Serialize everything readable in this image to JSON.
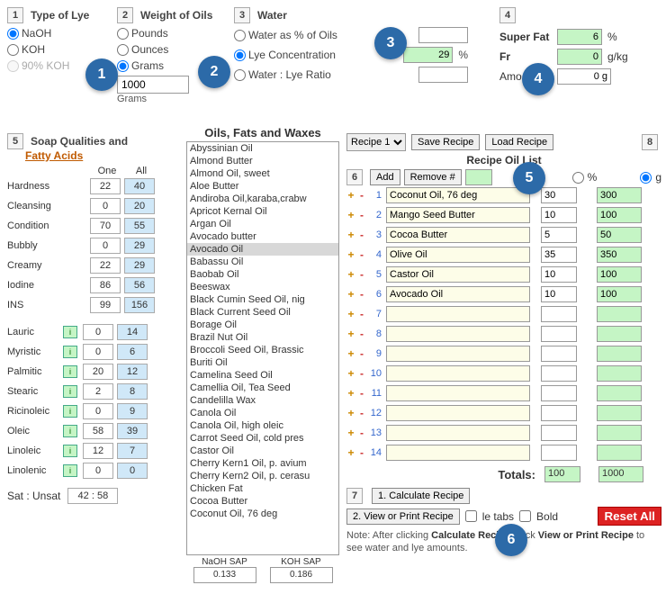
{
  "panel1": {
    "title": "Type of Lye",
    "opts": [
      "NaOH",
      "KOH",
      "90% KOH"
    ],
    "selected": 0
  },
  "panel2": {
    "title": "Weight of Oils",
    "opts": [
      "Pounds",
      "Ounces",
      "Grams"
    ],
    "selected": 2,
    "value": "1000",
    "unit_label": "Grams"
  },
  "panel3": {
    "title": "Water",
    "opts": [
      "Water as % of Oils",
      "Lye Concentration",
      "Water : Lye Ratio"
    ],
    "selected": 1,
    "values": [
      "",
      "29",
      ""
    ],
    "pct": "%"
  },
  "panel4": {
    "step": "4",
    "rows": [
      {
        "label": "Super Fat",
        "value": "6",
        "unit": "%"
      },
      {
        "label": "Fr",
        "value": "0",
        "unit": "g/kg"
      },
      {
        "label": "Amo",
        "value": "0 g",
        "unit": ""
      }
    ]
  },
  "soap_qualities": {
    "step": "5",
    "title": "Soap Qualities and",
    "fatty_acids": "Fatty Acids",
    "col_one": "One",
    "col_all": "All",
    "rows": [
      {
        "label": "Hardness",
        "one": "22",
        "all": "40"
      },
      {
        "label": "Cleansing",
        "one": "0",
        "all": "20"
      },
      {
        "label": "Condition",
        "one": "70",
        "all": "55"
      },
      {
        "label": "Bubbly",
        "one": "0",
        "all": "29"
      },
      {
        "label": "Creamy",
        "one": "22",
        "all": "29"
      },
      {
        "label": "Iodine",
        "one": "86",
        "all": "56"
      },
      {
        "label": "INS",
        "one": "99",
        "all": "156"
      }
    ],
    "acids": [
      {
        "label": "Lauric",
        "one": "0",
        "all": "14"
      },
      {
        "label": "Myristic",
        "one": "0",
        "all": "6"
      },
      {
        "label": "Palmitic",
        "one": "20",
        "all": "12"
      },
      {
        "label": "Stearic",
        "one": "2",
        "all": "8"
      },
      {
        "label": "Ricinoleic",
        "one": "0",
        "all": "9"
      },
      {
        "label": "Oleic",
        "one": "58",
        "all": "39"
      },
      {
        "label": "Linoleic",
        "one": "12",
        "all": "7"
      },
      {
        "label": "Linolenic",
        "one": "0",
        "all": "0"
      }
    ],
    "sat_label": "Sat : Unsat",
    "sat_value": "42 : 58"
  },
  "oils": {
    "title": "Oils, Fats and Waxes",
    "list": [
      "Abyssinian Oil",
      "Almond Butter",
      "Almond Oil, sweet",
      "Aloe Butter",
      "Andiroba Oil,karaba,crabw",
      "Apricot Kernal Oil",
      "Argan Oil",
      "Avocado butter",
      "Avocado Oil",
      "Babassu Oil",
      "Baobab Oil",
      "Beeswax",
      "Black Cumin Seed Oil, nig",
      "Black Current Seed Oil",
      "Borage Oil",
      "Brazil Nut Oil",
      "Broccoli Seed Oil, Brassic",
      "Buriti Oil",
      "Camelina Seed Oil",
      "Camellia Oil, Tea Seed",
      "Candelilla Wax",
      "Canola Oil",
      "Canola Oil, high oleic",
      "Carrot Seed Oil, cold pres",
      "Castor Oil",
      "Cherry Kern1 Oil, p. avium",
      "Cherry Kern2 Oil, p. cerasu",
      "Chicken Fat",
      "Cocoa Butter",
      "Coconut Oil, 76 deg"
    ],
    "selected_index": 8,
    "sap": {
      "naoh_label": "NaOH SAP",
      "koh_label": "KOH SAP",
      "naoh_value": "0.133",
      "koh_value": "0.186"
    }
  },
  "recipe": {
    "select_label": "Recipe 1",
    "save_btn": "Save Recipe",
    "load_btn": "Load Recipe",
    "step8": "8",
    "title": "Recipe Oil List",
    "step6": "6",
    "add_btn": "Add",
    "remove_btn": "Remove #",
    "remove_value": "",
    "pct_label": "%",
    "g_label": "g",
    "rows": [
      {
        "name": "Coconut Oil, 76 deg",
        "pct": "30",
        "g": "300"
      },
      {
        "name": "Mango Seed Butter",
        "pct": "10",
        "g": "100"
      },
      {
        "name": "Cocoa Butter",
        "pct": "5",
        "g": "50"
      },
      {
        "name": "Olive Oil",
        "pct": "35",
        "g": "350"
      },
      {
        "name": "Castor Oil",
        "pct": "10",
        "g": "100"
      },
      {
        "name": "Avocado Oil",
        "pct": "10",
        "g": "100"
      },
      {
        "name": "",
        "pct": "",
        "g": ""
      },
      {
        "name": "",
        "pct": "",
        "g": ""
      },
      {
        "name": "",
        "pct": "",
        "g": ""
      },
      {
        "name": "",
        "pct": "",
        "g": ""
      },
      {
        "name": "",
        "pct": "",
        "g": ""
      },
      {
        "name": "",
        "pct": "",
        "g": ""
      },
      {
        "name": "",
        "pct": "",
        "g": ""
      },
      {
        "name": "",
        "pct": "",
        "g": ""
      }
    ],
    "totals_label": "Totals:",
    "totals_pct": "100",
    "totals_g": "1000",
    "step7": "7",
    "calc_btn": "1. Calculate Recipe",
    "view_btn": "2. View or Print Recipe",
    "multi_tabs": "le tabs",
    "bold": "Bold",
    "reset_btn": "Reset All",
    "note_a": "Note: After clicking ",
    "note_b": "Calculate Recipe",
    "note_c": ", click ",
    "note_d": "View or Print Recipe",
    "note_e": " to see water and lye amounts."
  },
  "annotations": [
    "1",
    "2",
    "3",
    "4",
    "5",
    "6"
  ]
}
